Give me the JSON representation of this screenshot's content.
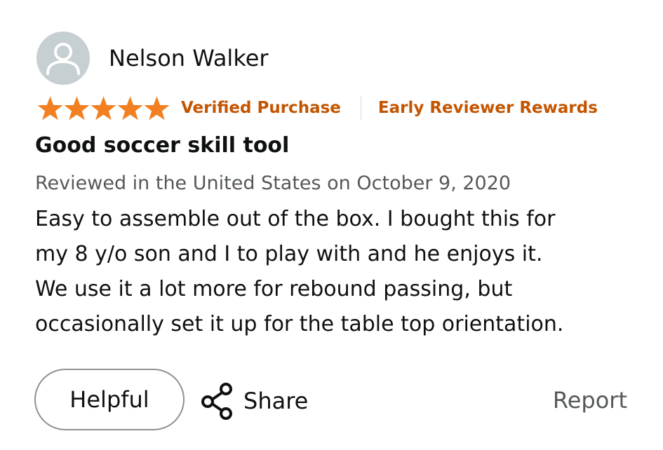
{
  "reviewer": {
    "name": "Nelson Walker",
    "avatar_icon": "default-user-avatar-icon"
  },
  "rating": {
    "stars": 5,
    "max": 5,
    "star_icon": "star-icon",
    "star_color": "#f28020"
  },
  "badges": {
    "verified": "Verified Purchase",
    "early_reviewer": "Early Reviewer Rewards",
    "color": "#c45500"
  },
  "review": {
    "title": "Good soccer skill tool",
    "date_line": "Reviewed in the United States on October 9, 2020",
    "body_lines": [
      "Easy to assemble out of the box. I bought this for",
      "my 8 y/o son and I to play with and he enjoys it.",
      "We use it a lot more for rebound passing, but",
      "occasionally set it up for the table top orientation."
    ]
  },
  "actions": {
    "helpful_label": "Helpful",
    "share_label": "Share",
    "share_icon": "share-icon",
    "report_label": "Report"
  }
}
